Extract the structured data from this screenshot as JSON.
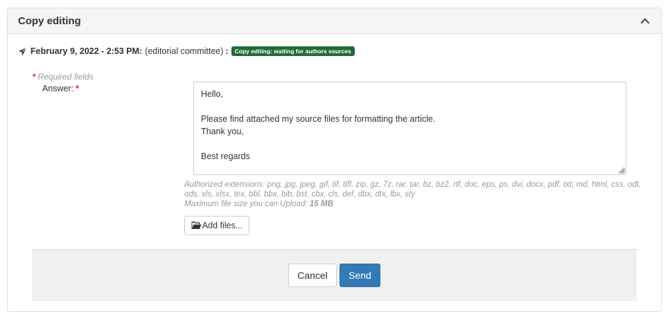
{
  "panel": {
    "title": "Copy editing",
    "collapse_icon": "chevron-up-icon"
  },
  "history": {
    "icon": "paper-plane-icon",
    "date": "February 9, 2022 - 2:53 PM:",
    "author": "(editorial committee)",
    "separator": ":",
    "status": "Copy editing: waiting for authors sources",
    "status_color": "#1f6b38"
  },
  "form": {
    "required_star": "*",
    "required_note": "Required fields",
    "answer_label": "Answer:",
    "answer_value": "Hello,\n\nPlease find attached my source files for formatting the article.\nThank you,\n\nBest regards",
    "extensions_text": "Authorized extensions: png, jpg, jpeg, gif, tif, tiff, zip, gz, 7z, rar, tar, bz, bz2, rtf, doc, eps, ps, dvi, docx, pdf, txt, md, html, css, odt, ods, xls, xlsx, tex, bbl, bbx, bib, bst, cbx, cls, def, dbx, dtx, lbx, sty",
    "max_size_label": "Maximum file size you can Upload:",
    "max_size_value": "15 MB",
    "add_files_label": "Add files...",
    "add_files_icon": "folder-open-icon"
  },
  "actions": {
    "cancel_label": "Cancel",
    "send_label": "Send",
    "send_color": "#337ab7"
  }
}
